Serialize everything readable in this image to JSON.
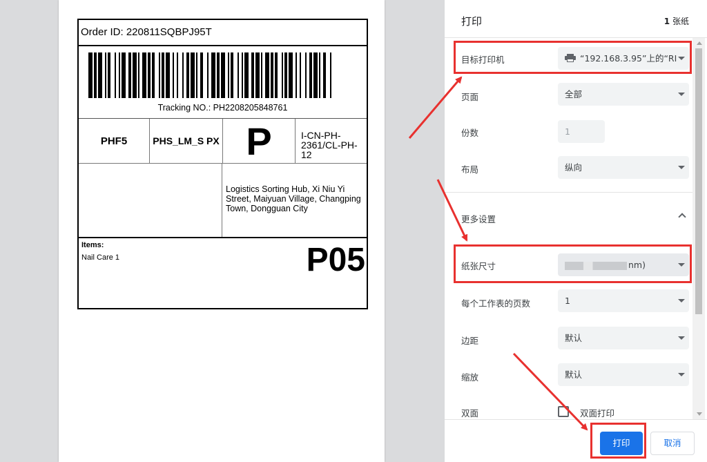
{
  "label": {
    "order_id": "Order ID: 220811SQBPJ95T",
    "tracking": "Tracking NO.: PH2208205848761",
    "code1": "PHF5",
    "code2": "PHS_LM_S PX",
    "code3": "P",
    "code4": "I-CN-PH-2361/CL-PH-12",
    "address": "Logistics Sorting Hub, Xi Niu Yi Street, Maiyuan Village, Changping Town, Dongguan City",
    "items_label": "Items:",
    "items_value": "Nail Care 1",
    "zone_code": "P05"
  },
  "panel": {
    "title": "打印",
    "sheet_count_num": "1",
    "sheet_count_unit": "张纸",
    "destination": {
      "label": "目标打印机",
      "value": "“192.168.3.95”上的“RI"
    },
    "pages": {
      "label": "页面",
      "value": "全部"
    },
    "copies": {
      "label": "份数",
      "value": "1"
    },
    "layout": {
      "label": "布局",
      "value": "纵向"
    },
    "more_settings": {
      "label": "更多设置"
    },
    "paper_size": {
      "label": "纸张尺寸",
      "value_suffix": "nm)"
    },
    "pages_per_sheet": {
      "label": "每个工作表的页数",
      "value": "1"
    },
    "margins": {
      "label": "边距",
      "value": "默认"
    },
    "scale": {
      "label": "缩放",
      "value": "默认"
    },
    "duplex": {
      "label": "双面",
      "option": "双面打印",
      "checked": false
    }
  },
  "footer": {
    "print_label": "打印",
    "cancel_label": "取消"
  },
  "colors": {
    "accent": "#1a73e8",
    "annotation": "#e8312f"
  }
}
